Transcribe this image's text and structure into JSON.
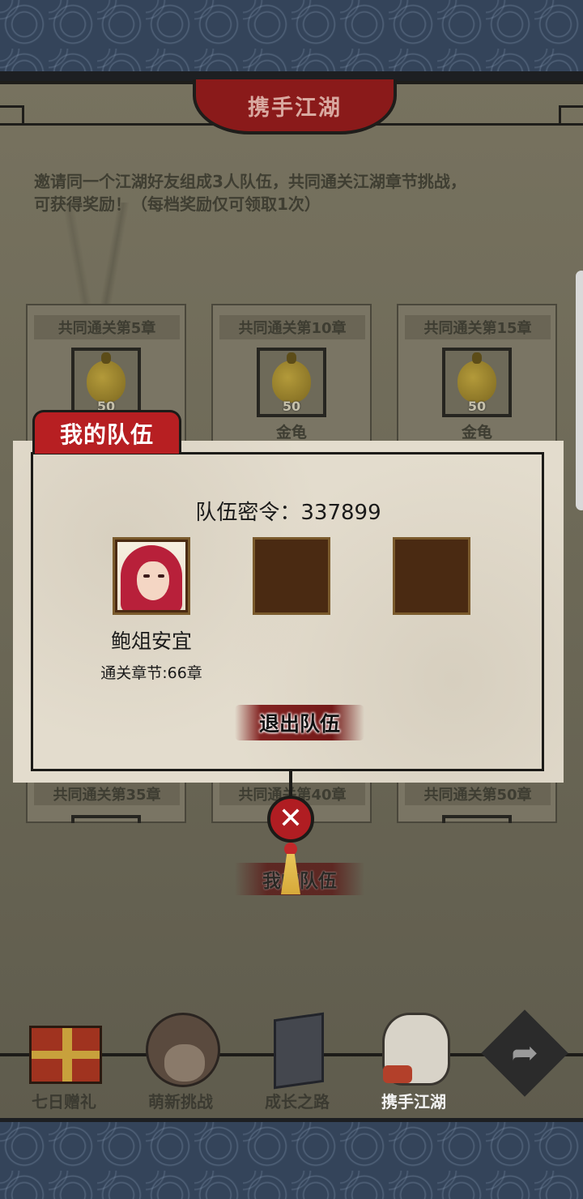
{
  "header": {
    "title": "携手江湖"
  },
  "intro": {
    "line1": "邀请同一个江湖好友组成3人队伍，共同通关江湖章节挑战，",
    "line2": "可获得奖励！（每档奖励仅可领取1次）"
  },
  "reward_cards": [
    {
      "title": "共同通关第5章",
      "qty": "50",
      "name": ""
    },
    {
      "title": "共同通关第10章",
      "qty": "50",
      "name": "金龟"
    },
    {
      "title": "共同通关第15章",
      "qty": "50",
      "name": "金龟"
    }
  ],
  "reward_cards_bottom": [
    {
      "title": "共同通关第35章"
    },
    {
      "title": "共同通关第40章"
    },
    {
      "title": "共同通关第50章"
    }
  ],
  "team_panel": {
    "tab_title": "我的队伍",
    "code_label": "队伍密令：337899",
    "member": {
      "name": "鲍俎安宜",
      "level": "通关章节:66章"
    },
    "quit_label": "退出队伍"
  },
  "close": {
    "label": "✕"
  },
  "my_team_button": "我的队伍",
  "nav": [
    {
      "label": "七日赠礼",
      "icon": "gift-box-icon"
    },
    {
      "label": "萌新挑战",
      "icon": "girl-avatar-icon"
    },
    {
      "label": "成长之路",
      "icon": "book-icon"
    },
    {
      "label": "携手江湖",
      "icon": "handshake-icon"
    }
  ],
  "share": {
    "icon": "share-arrow-icon",
    "glyph": "➦"
  },
  "colors": {
    "accent_red": "#b71f22",
    "panel_bg": "#e3dccd",
    "slot_brown": "#4a2a12"
  }
}
